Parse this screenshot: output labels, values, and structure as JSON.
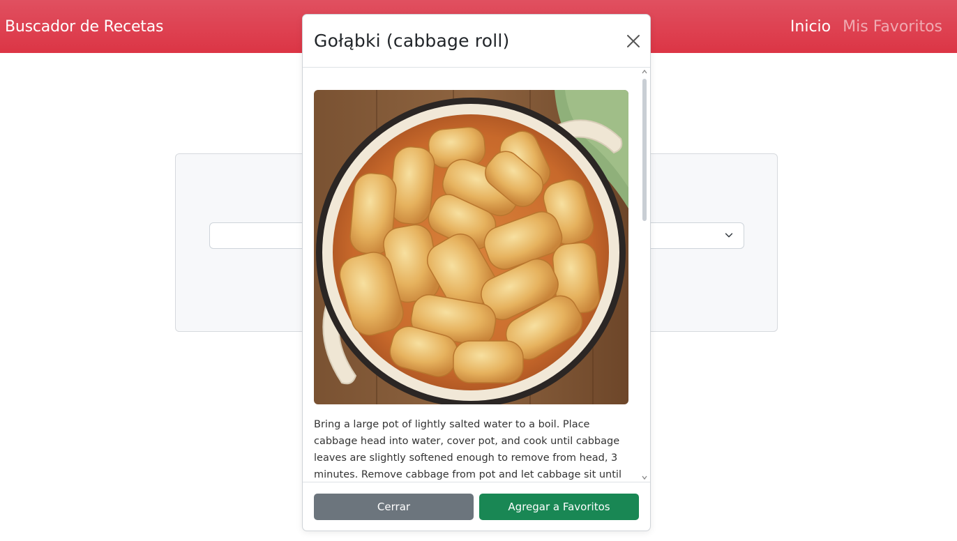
{
  "navbar": {
    "brand": "Buscador de Recetas",
    "links": [
      {
        "label": "Inicio"
      },
      {
        "label": "Mis Favoritos"
      }
    ],
    "colors": {
      "background": "#dc3545"
    }
  },
  "modal": {
    "title": "Gołąbki (cabbage roll)",
    "close_icon": "close-icon",
    "image_alt": "Gołąbki (cabbage roll)",
    "instructions": "Bring a large pot of lightly salted water to a boil. Place cabbage head into water, cover pot, and cook until cabbage leaves are slightly softened enough to remove from head, 3 minutes. Remove cabbage from pot and let cabbage sit until leaves are",
    "buttons": {
      "close_label": "Cerrar",
      "favorite_label": "Agregar a Favoritos"
    },
    "colors": {
      "secondary": "#6c757d",
      "success": "#198754"
    }
  }
}
